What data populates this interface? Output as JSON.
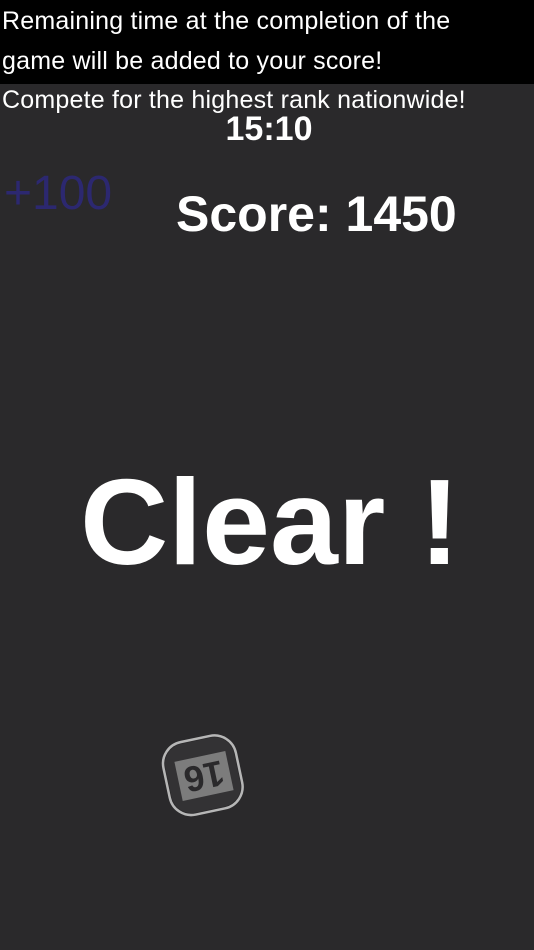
{
  "banner": {
    "line1": "Remaining time at the completion of the",
    "line2": "game will be added to your score!",
    "line3": "Compete for the highest rank nationwide!"
  },
  "timer": "15:10",
  "bonus": "+100",
  "score": "Score: 1450",
  "clear_message": "Clear !",
  "tile": {
    "number": "16",
    "orientation": "upside-down",
    "state": "faded"
  },
  "colors": {
    "background": "#2a292b",
    "banner_background": "#000000",
    "text": "#ffffff",
    "bonus_text": "#2c2870",
    "tile_outline": "#cfcfcf"
  }
}
